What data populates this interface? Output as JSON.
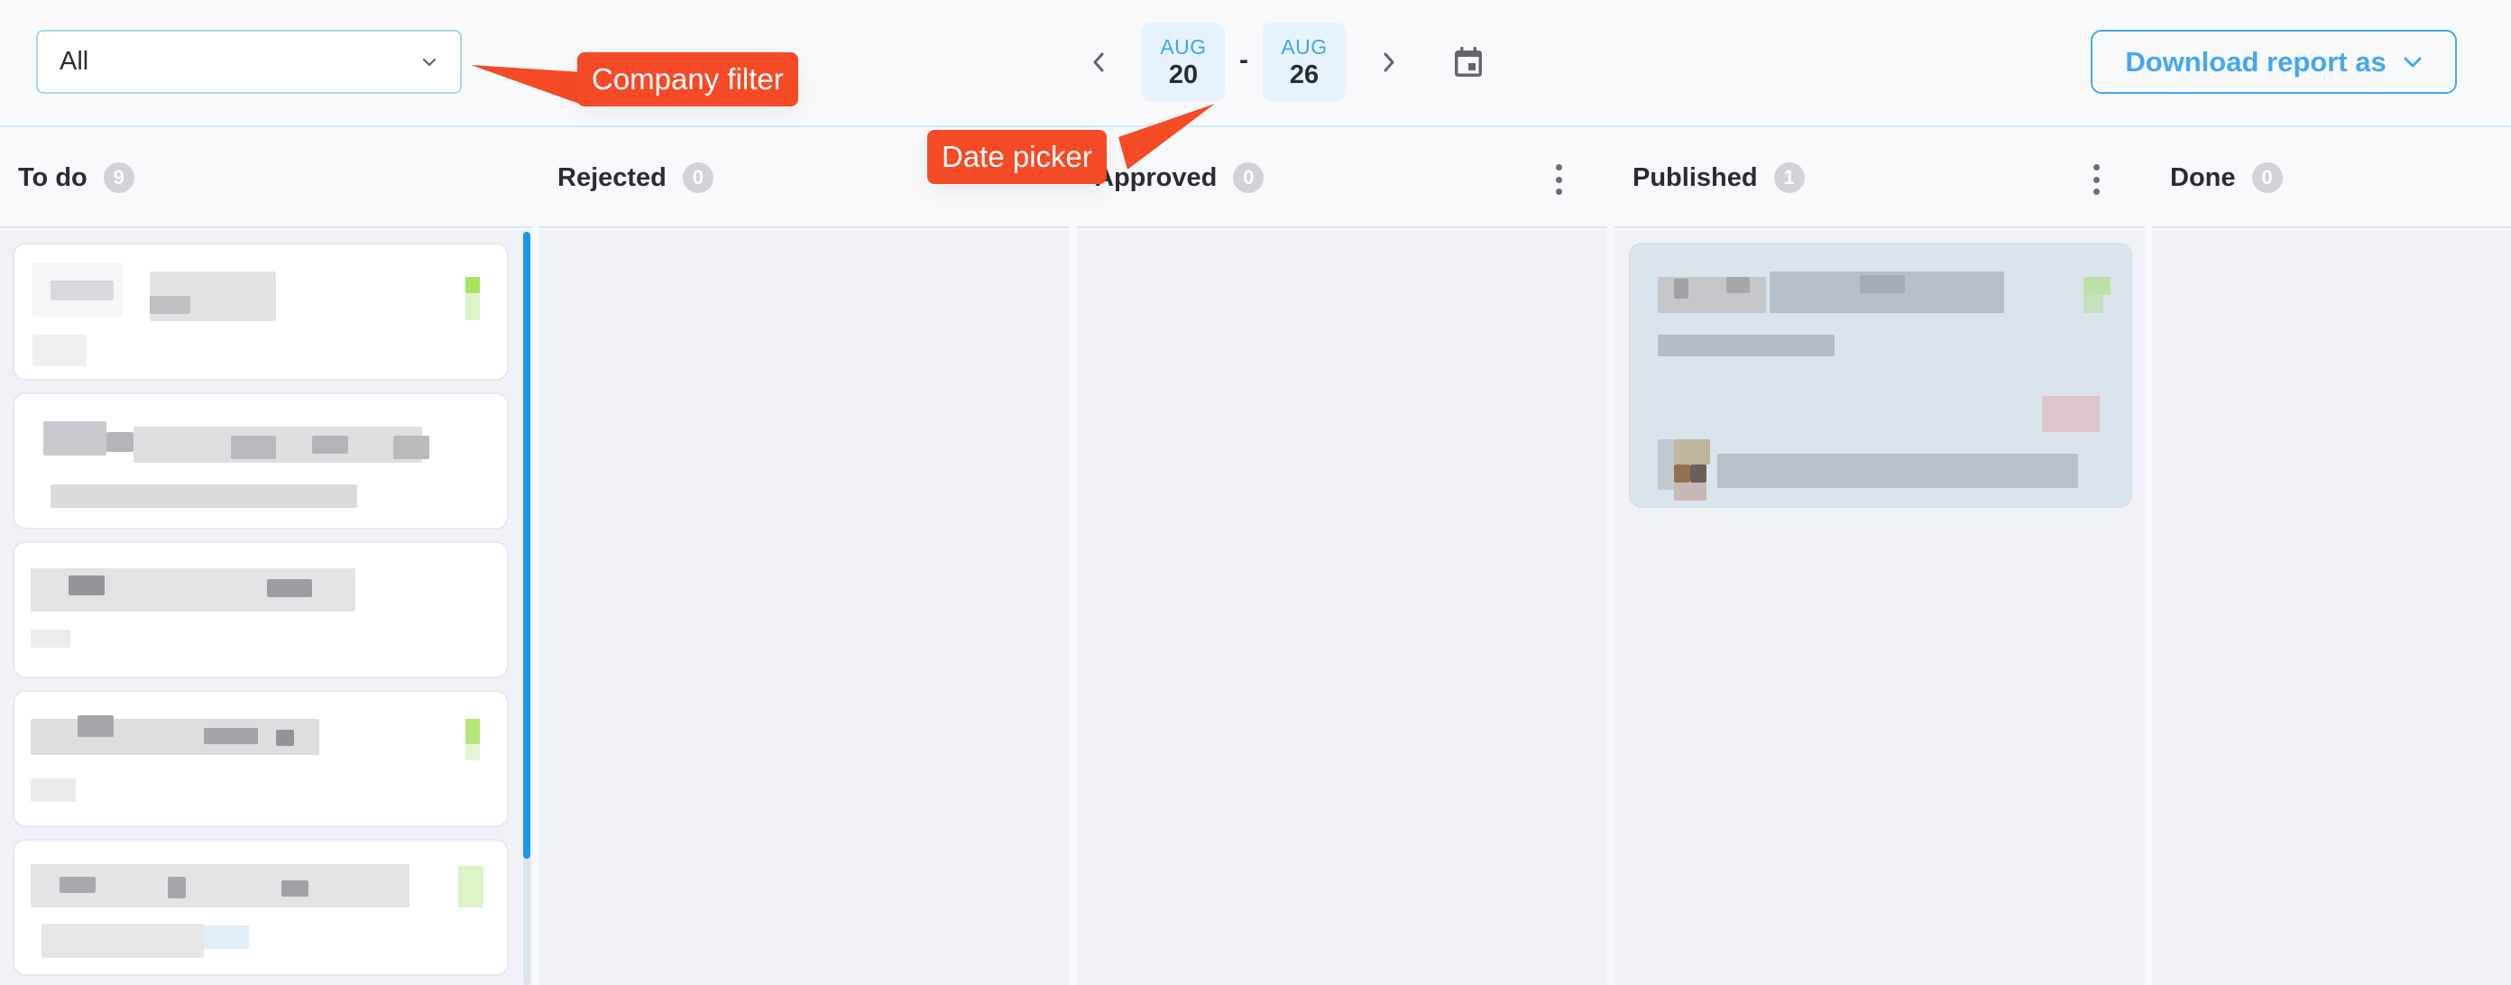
{
  "toolbar": {
    "company_filter": {
      "value": "All",
      "icon": "chevron-down-icon"
    },
    "date_range": {
      "prev_icon": "chevron-left-icon",
      "next_icon": "chevron-right-icon",
      "start": {
        "month": "AUG",
        "day": "20"
      },
      "separator": "-",
      "end": {
        "month": "AUG",
        "day": "26"
      },
      "calendar_icon": "calendar-icon"
    },
    "download": {
      "label": "Download report as",
      "icon": "chevron-down-icon"
    }
  },
  "columns": [
    {
      "title": "To do",
      "count": "9",
      "has_menu": false,
      "cards_visible": 5
    },
    {
      "title": "Rejected",
      "count": "0",
      "has_menu": false,
      "cards_visible": 0
    },
    {
      "title": "Approved",
      "count": "0",
      "has_menu": true,
      "cards_visible": 0
    },
    {
      "title": "Published",
      "count": "1",
      "has_menu": true,
      "cards_visible": 1
    },
    {
      "title": "Done",
      "count": "0",
      "has_menu": false,
      "cards_visible": 0
    }
  ],
  "cards_content": "redacted",
  "annotations": [
    {
      "label": "Company filter",
      "target": "company-filter"
    },
    {
      "label": "Date picker",
      "target": "date-picker"
    }
  ],
  "colors": {
    "accent": "#44a7f0",
    "annotation": "#f44a26",
    "scroll_thumb": "#1a96f1",
    "count_badge": "#ced4d9",
    "column_bg": "#eef2f7",
    "published_card_bg": "#dae4ed"
  }
}
